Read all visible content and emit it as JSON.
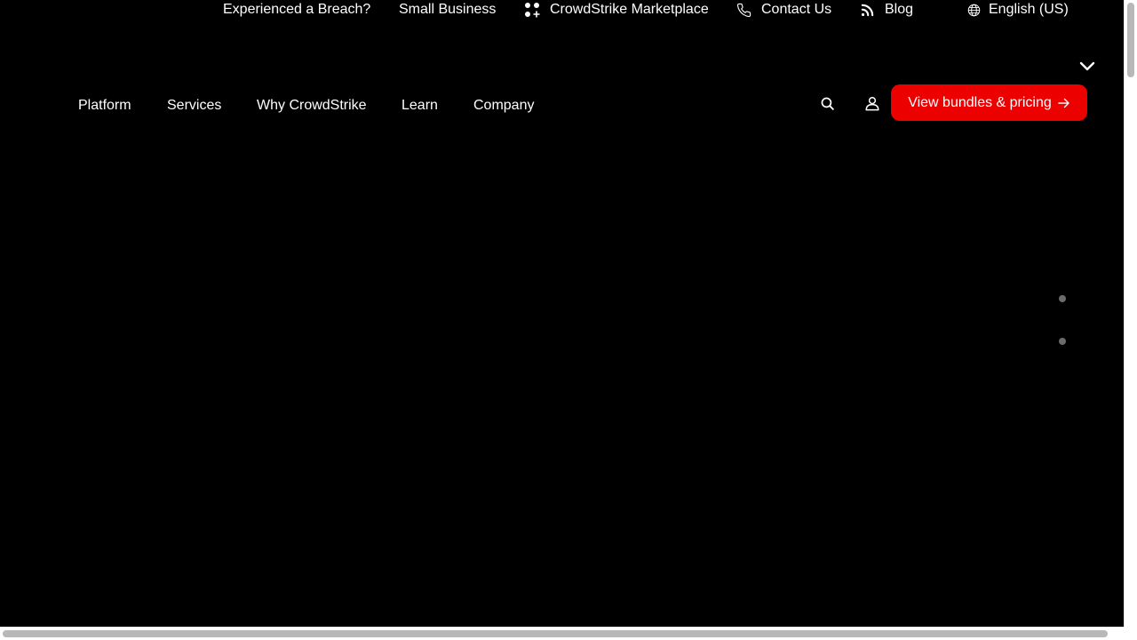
{
  "colors": {
    "background": "#000000",
    "text": "#ffffff",
    "accent": "#ec0000",
    "dot": "#6b6b6b",
    "scrollbar_thumb": "#b8b8b8"
  },
  "utility_nav": {
    "breach": "Experienced a Breach?",
    "small_business": "Small Business",
    "marketplace": {
      "label": "CrowdStrike Marketplace",
      "icon": "grid-plus-icon"
    },
    "contact": {
      "label": "Contact Us",
      "icon": "phone-icon"
    },
    "blog": {
      "label": "Blog",
      "icon": "rss-icon"
    },
    "language": {
      "label": "English (US)",
      "icon": "globe-icon",
      "chevron": "chevron-down-icon"
    }
  },
  "main_nav": {
    "items": [
      "Platform",
      "Services",
      "Why CrowdStrike",
      "Learn",
      "Company"
    ]
  },
  "actions": {
    "search_icon": "search-icon",
    "account_icon": "user-icon",
    "cta": {
      "label": "View bundles & pricing",
      "icon": "arrow-right-icon"
    }
  },
  "carousel": {
    "dots": 2
  }
}
